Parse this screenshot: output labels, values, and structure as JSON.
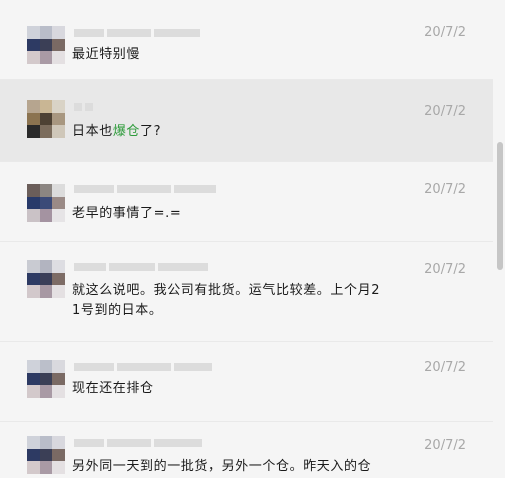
{
  "messages": [
    {
      "date": "20/7/2",
      "text": "最近特别慢"
    },
    {
      "date": "20/7/2",
      "text_before": "日本也",
      "text_highlight": "爆仓",
      "text_after": "了?"
    },
    {
      "date": "20/7/2",
      "text": "老早的事情了=.="
    },
    {
      "date": "20/7/2",
      "text_line1": "就这么说吧。我公司有批货。运气比较差。上个月2",
      "text_line2": "1号到的日本。"
    },
    {
      "date": "20/7/2",
      "text": "现在还在排仓"
    },
    {
      "date": "20/7/2",
      "text": "另外同一天到的一批货，另外一个仓。昨天入的仓"
    }
  ],
  "colors": {
    "highlight_word": "#2e9b3b",
    "selected_row_bg": "#e8e8e8",
    "date_text": "#a8a8a8"
  }
}
